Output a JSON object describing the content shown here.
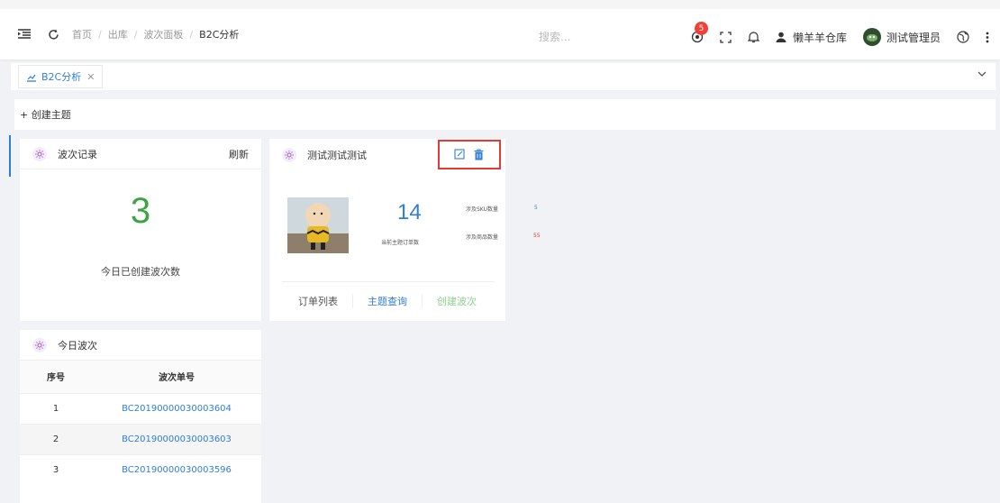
{
  "header": {
    "breadcrumbs": [
      "首页",
      "出库",
      "波次面板",
      "B2C分析"
    ],
    "search_placeholder": "搜索...",
    "notification_count": "5",
    "warehouse": "懒羊羊仓库",
    "user": "测试管理员"
  },
  "tabs": [
    {
      "label": "B2C分析"
    }
  ],
  "create_topic": "+ 创建主题",
  "wave_record": {
    "title": "波次记录",
    "refresh": "刷新",
    "count": "3",
    "caption": "今日已创建波次数"
  },
  "topic_card": {
    "title": "测试测试测试",
    "order_count": "14",
    "order_count_label": "当前主题订单数",
    "sku_label": "涉及SKU数量",
    "sku_value": "5",
    "goods_label": "涉及商品数量",
    "goods_value": "55",
    "actions": [
      "订单列表",
      "主题查询",
      "创建波次"
    ]
  },
  "today_waves": {
    "title": "今日波次",
    "columns": [
      "序号",
      "波次单号"
    ],
    "rows": [
      [
        "1",
        "BC20190000030003604"
      ],
      [
        "2",
        "BC20190000030003603"
      ],
      [
        "3",
        "BC20190000030003596"
      ]
    ]
  },
  "colors": {
    "accent": "#2f7ed8",
    "green": "#3aa542",
    "red": "#e53935"
  }
}
